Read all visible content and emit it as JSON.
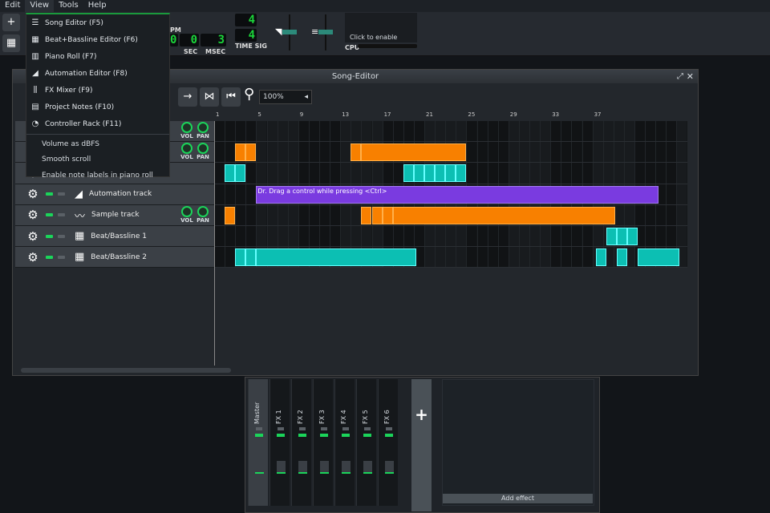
{
  "menubar": [
    "Edit",
    "View",
    "Tools",
    "Help"
  ],
  "view_menu": {
    "items": [
      {
        "icon": "song-editor-icon",
        "glyph": "☰",
        "label": "Song Editor (F5)"
      },
      {
        "icon": "beat-bassline-icon",
        "glyph": "▦",
        "label": "Beat+Bassline Editor (F6)"
      },
      {
        "icon": "piano-roll-icon",
        "glyph": "▥",
        "label": "Piano Roll (F7)"
      },
      {
        "icon": "automation-icon",
        "glyph": "◢",
        "label": "Automation Editor (F8)"
      },
      {
        "icon": "fx-mixer-icon",
        "glyph": "⫼",
        "label": "FX Mixer (F9)"
      },
      {
        "icon": "project-notes-icon",
        "glyph": "▤",
        "label": "Project Notes (F10)"
      },
      {
        "icon": "controller-rack-icon",
        "glyph": "◔",
        "label": "Controller Rack (F11)"
      }
    ],
    "options": [
      "Volume as dBFS",
      "Smooth scroll",
      "Enable note labels in piano roll"
    ]
  },
  "transport": {
    "bpm_label": "PM",
    "sec": "0",
    "msec": "3",
    "sec_label": "SEC",
    "msec_label": "MSEC",
    "timesig_num": "4",
    "timesig_den": "4",
    "timesig_label": "TIME SIG",
    "cpu_hint": "Click to enable",
    "cpu_label": "CPU"
  },
  "song_editor": {
    "title": "Song-Editor",
    "zoom": "100%",
    "ruler": [
      "1",
      "5",
      "9",
      "13",
      "17",
      "21",
      "25",
      "29",
      "33",
      "37"
    ],
    "tracks": [
      {
        "name": "",
        "type": "instrument",
        "knobs": [
          "VOL",
          "PAN"
        ],
        "clips": []
      },
      {
        "name": "",
        "type": "instrument",
        "knobs": [
          "VOL",
          "PAN"
        ],
        "clips": [
          {
            "c": "o",
            "s": 2,
            "l": 1
          },
          {
            "c": "o",
            "s": 3,
            "l": 1
          },
          {
            "c": "o",
            "s": 13,
            "l": 1
          },
          {
            "c": "o",
            "s": 14,
            "l": 10
          }
        ]
      },
      {
        "name": "",
        "type": "bb",
        "clips": [
          {
            "c": "t",
            "s": 1,
            "l": 1
          },
          {
            "c": "t",
            "s": 2,
            "l": 1
          },
          {
            "c": "t",
            "s": 18,
            "l": 1
          },
          {
            "c": "t",
            "s": 19,
            "l": 1
          },
          {
            "c": "t",
            "s": 20,
            "l": 1
          },
          {
            "c": "t",
            "s": 21,
            "l": 1
          },
          {
            "c": "t",
            "s": 22,
            "l": 1
          },
          {
            "c": "t",
            "s": 23,
            "l": 1
          }
        ]
      },
      {
        "name": "Automation track",
        "type": "automation",
        "icon": "automation-track-icon",
        "clips": [
          {
            "c": "p",
            "s": 4,
            "l": 38.3,
            "label": "Dr. Drag a control while pressing <Ctrl>"
          }
        ]
      },
      {
        "name": "Sample track",
        "type": "sample",
        "icon": "waveform-icon",
        "knobs": [
          "VOL",
          "PAN"
        ],
        "clips": [
          {
            "c": "o",
            "s": 1,
            "l": 1
          },
          {
            "c": "o",
            "s": 14,
            "l": 1
          },
          {
            "c": "o",
            "s": 15,
            "l": 1
          },
          {
            "c": "o",
            "s": 16,
            "l": 1
          },
          {
            "c": "o",
            "s": 17,
            "l": 21.2
          }
        ]
      },
      {
        "name": "Beat/Bassline 1",
        "type": "bb",
        "icon": "beat-icon",
        "clips": [
          {
            "c": "t",
            "s": 37.3,
            "l": 1
          },
          {
            "c": "t",
            "s": 38.3,
            "l": 1
          },
          {
            "c": "t",
            "s": 39.3,
            "l": 1
          }
        ]
      },
      {
        "name": "Beat/Bassline 2",
        "type": "bb",
        "icon": "beat-icon",
        "clips": [
          {
            "c": "t",
            "s": 2,
            "l": 1
          },
          {
            "c": "t",
            "s": 3,
            "l": 1
          },
          {
            "c": "t",
            "s": 4,
            "l": 15.2
          },
          {
            "c": "t",
            "s": 36.3,
            "l": 1
          },
          {
            "c": "t",
            "s": 38.3,
            "l": 1
          },
          {
            "c": "t",
            "s": 40.3,
            "l": 4
          }
        ]
      }
    ]
  },
  "mixer": {
    "channels": [
      "Master",
      "FX 1",
      "FX 2",
      "FX 3",
      "FX 4",
      "FX 5",
      "FX 6"
    ],
    "add_channel": "+",
    "add_effect": "Add effect"
  }
}
